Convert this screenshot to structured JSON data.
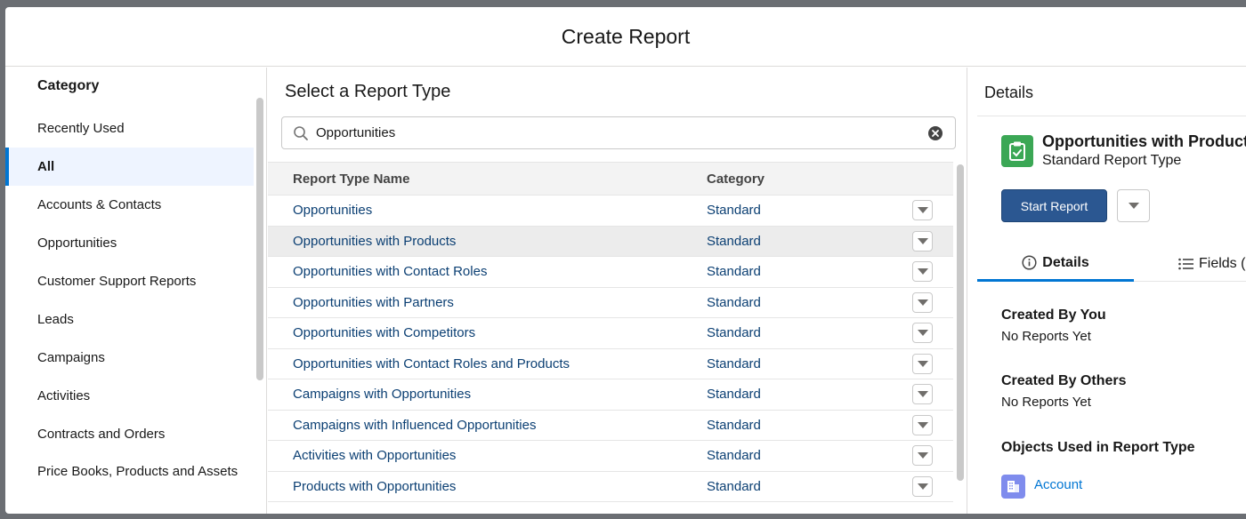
{
  "modal": {
    "title": "Create Report"
  },
  "sidebar": {
    "heading": "Category",
    "items": [
      {
        "label": "Recently Used",
        "active": false
      },
      {
        "label": "All",
        "active": true
      },
      {
        "label": "Accounts & Contacts",
        "active": false
      },
      {
        "label": "Opportunities",
        "active": false
      },
      {
        "label": "Customer Support Reports",
        "active": false
      },
      {
        "label": "Leads",
        "active": false
      },
      {
        "label": "Campaigns",
        "active": false
      },
      {
        "label": "Activities",
        "active": false
      },
      {
        "label": "Contracts and Orders",
        "active": false
      },
      {
        "label": "Price Books, Products and Assets",
        "active": false
      }
    ]
  },
  "center": {
    "title": "Select a Report Type",
    "search": {
      "value": "Opportunities",
      "icon": "search-icon",
      "clear_icon": "clear-icon"
    },
    "columns": {
      "name": "Report Type Name",
      "category": "Category"
    },
    "rows": [
      {
        "name": "Opportunities",
        "category": "Standard"
      },
      {
        "name": "Opportunities with Products",
        "category": "Standard",
        "hovered": true
      },
      {
        "name": "Opportunities with Contact Roles",
        "category": "Standard"
      },
      {
        "name": "Opportunities with Partners",
        "category": "Standard"
      },
      {
        "name": "Opportunities with Competitors",
        "category": "Standard"
      },
      {
        "name": "Opportunities with Contact Roles and Products",
        "category": "Standard"
      },
      {
        "name": "Campaigns with Opportunities",
        "category": "Standard"
      },
      {
        "name": "Campaigns with Influenced Opportunities",
        "category": "Standard"
      },
      {
        "name": "Activities with Opportunities",
        "category": "Standard"
      },
      {
        "name": "Products with Opportunities",
        "category": "Standard"
      }
    ]
  },
  "details": {
    "heading": "Details",
    "report_type_name": "Opportunities with Products",
    "report_type_kind": "Standard Report Type",
    "start_button": "Start Report",
    "tabs": {
      "details": "Details",
      "fields": "Fields ("
    },
    "created_by_you": {
      "title": "Created By You",
      "value": "No Reports Yet"
    },
    "created_by_others": {
      "title": "Created By Others",
      "value": "No Reports Yet"
    },
    "objects_used": {
      "title": "Objects Used in Report Type",
      "items": [
        "Account"
      ]
    },
    "colors": {
      "accent": "#0176d3",
      "report_icon": "#3ba755",
      "object_icon": "#7f8ced",
      "button": "#2b5791"
    }
  }
}
